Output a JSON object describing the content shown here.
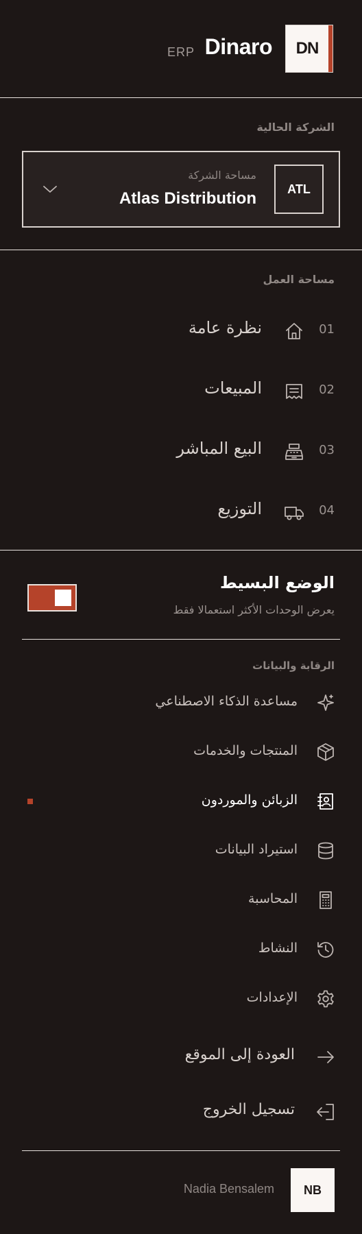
{
  "header": {
    "logo_initials": "DN",
    "brand_name": "Dinaro",
    "brand_suffix": "ERP"
  },
  "company": {
    "section_label": "الشركة الحالية",
    "badge": "ATL",
    "subtitle": "مساحة الشركة",
    "name": "Atlas Distribution"
  },
  "workspace": {
    "section_label": "مساحة العمل",
    "items": [
      {
        "num": "01",
        "label": "نظرة عامة",
        "icon": "home-icon"
      },
      {
        "num": "02",
        "label": "المبيعات",
        "icon": "receipt-icon"
      },
      {
        "num": "03",
        "label": "البيع المباشر",
        "icon": "cash-register-icon"
      },
      {
        "num": "04",
        "label": "التوزيع",
        "icon": "truck-icon"
      }
    ]
  },
  "simple_mode": {
    "title": "الوضع البسيط",
    "subtitle": "يعرض الوحدات الأكثر استعمالا فقط",
    "enabled": true
  },
  "tools": {
    "section_label": "الرقابة والبيانات",
    "items": [
      {
        "label": "مساعدة الذكاء الاصطناعي",
        "icon": "sparkle-icon",
        "active": false
      },
      {
        "label": "المنتجات والخدمات",
        "icon": "box-icon",
        "active": false
      },
      {
        "label": "الزبائن والموردون",
        "icon": "contacts-icon",
        "active": true
      },
      {
        "label": "استيراد البيانات",
        "icon": "database-icon",
        "active": false
      },
      {
        "label": "المحاسبة",
        "icon": "calculator-icon",
        "active": false
      },
      {
        "label": "النشاط",
        "icon": "history-icon",
        "active": false
      },
      {
        "label": "الإعدادات",
        "icon": "gear-icon",
        "active": false
      }
    ]
  },
  "footer_links": {
    "back_to_site": "العودة إلى الموقع",
    "logout": "تسجيل الخروج"
  },
  "user": {
    "initials": "NB",
    "name": "Nadia Bensalem"
  },
  "colors": {
    "background": "#1d1716",
    "accent": "#b5432a",
    "text": "#efe9e6"
  }
}
